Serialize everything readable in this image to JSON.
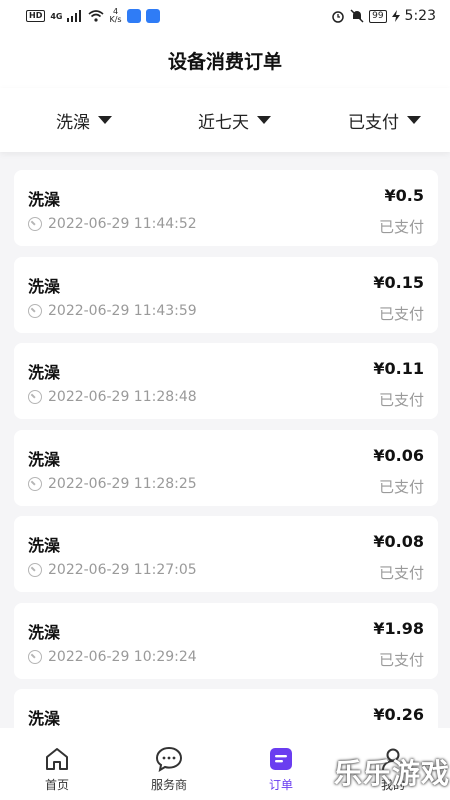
{
  "status_bar": {
    "hd_badge": "HD",
    "network": "4G",
    "speed_value": "4",
    "speed_unit": "K/s",
    "battery": "99",
    "time": "5:23"
  },
  "header": {
    "title": "设备消费订单"
  },
  "filters": [
    {
      "label": "洗澡"
    },
    {
      "label": "近七天"
    },
    {
      "label": "已支付"
    }
  ],
  "orders": [
    {
      "name": "洗澡",
      "time": "2022-06-29 11:44:52",
      "amount": "¥0.5",
      "status": "已支付"
    },
    {
      "name": "洗澡",
      "time": "2022-06-29 11:43:59",
      "amount": "¥0.15",
      "status": "已支付"
    },
    {
      "name": "洗澡",
      "time": "2022-06-29 11:28:48",
      "amount": "¥0.11",
      "status": "已支付"
    },
    {
      "name": "洗澡",
      "time": "2022-06-29 11:28:25",
      "amount": "¥0.06",
      "status": "已支付"
    },
    {
      "name": "洗澡",
      "time": "2022-06-29 11:27:05",
      "amount": "¥0.08",
      "status": "已支付"
    },
    {
      "name": "洗澡",
      "time": "2022-06-29 10:29:24",
      "amount": "¥1.98",
      "status": "已支付"
    },
    {
      "name": "洗澡",
      "time": "",
      "amount": "¥0.26",
      "status": ""
    }
  ],
  "tabbar": {
    "items": [
      {
        "label": "首页",
        "icon": "home-icon"
      },
      {
        "label": "服务商",
        "icon": "chat-bubble-icon"
      },
      {
        "label": "订单",
        "icon": "order-icon"
      },
      {
        "label": "我的",
        "icon": "user-icon"
      }
    ],
    "active_color": "#6a3df0"
  },
  "watermark": "乐乐游戏"
}
